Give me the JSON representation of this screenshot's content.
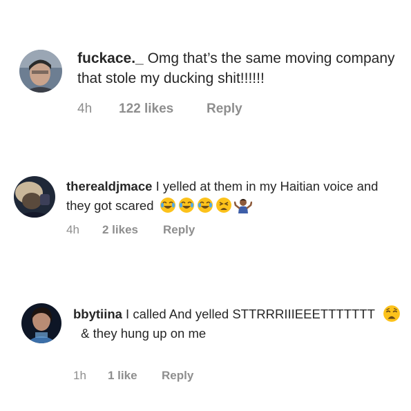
{
  "comments": [
    {
      "username": "fuckace._",
      "text": " Omg that’s the same moving company that stole my ducking shit!!!!!!",
      "time": "4h",
      "likes": "122 likes",
      "reply": "Reply",
      "avatar_icon": "profile-photo"
    },
    {
      "username": "therealdjmace",
      "text": " I yelled at them in my Haitian voice and they got scared",
      "emojis": [
        "face-with-tears-of-joy",
        "face-with-tears-of-joy",
        "face-with-tears-of-joy",
        "tired-face",
        "person-shrugging"
      ],
      "time": "4h",
      "likes": "2 likes",
      "reply": "Reply",
      "avatar_icon": "profile-photo"
    },
    {
      "username": "bbytiina",
      "text_before": " I called And yelled STTRRRIIIEEETTTTTTT ",
      "emojis": [
        "weary-face"
      ],
      "text_after": " & they hung up on me",
      "time": "1h",
      "likes": "1 like",
      "reply": "Reply",
      "avatar_icon": "profile-photo"
    }
  ],
  "colors": {
    "text": "#262626",
    "meta": "#8e8e8e",
    "background": "#ffffff",
    "emoji_yellow": "#fcc21b"
  }
}
